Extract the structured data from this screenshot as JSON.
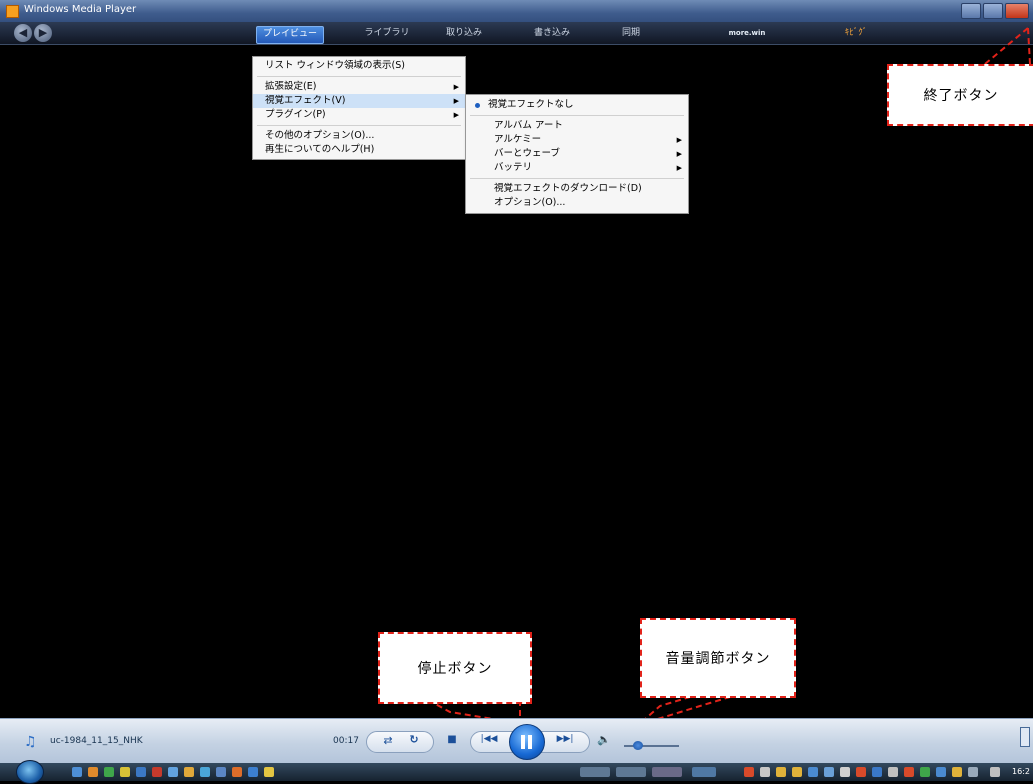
{
  "window": {
    "title": "Windows Media Player"
  },
  "navbar": {
    "back_icon": "back-arrow-icon",
    "forward_icon": "forward-arrow-icon",
    "tabs": [
      {
        "label": "プレイビュー",
        "active": true
      },
      {
        "label": "ライブラリ"
      },
      {
        "label": "取り込み"
      },
      {
        "label": "書き込み"
      },
      {
        "label": "同期"
      },
      {
        "label": "more.win"
      },
      {
        "label": "ｷﾋﾞｸﾞ"
      }
    ]
  },
  "menu": {
    "items": [
      {
        "label": "リスト ウィンドウ領域の表示(S)"
      },
      {
        "label": "拡張設定(E)",
        "submenu": true
      },
      {
        "label": "視覚エフェクト(V)",
        "submenu": true,
        "highlighted": true
      },
      {
        "label": "プラグイン(P)",
        "submenu": true
      },
      {
        "label": "その他のオプション(O)..."
      },
      {
        "label": "再生についてのヘルプ(H)"
      }
    ]
  },
  "submenu": {
    "items": [
      {
        "label": "視覚エフェクトなし",
        "selected": true
      },
      {
        "label": "アルバム アート"
      },
      {
        "label": "アルケミー",
        "submenu": true
      },
      {
        "label": "バーとウェーブ",
        "submenu": true
      },
      {
        "label": "バッテリ",
        "submenu": true
      },
      {
        "label": "視覚エフェクトのダウンロード(D)"
      },
      {
        "label": "オプション(O)..."
      }
    ]
  },
  "annotations": {
    "exit": "終了ボタン",
    "stop": "停止ボタン",
    "volume": "音量調節ボタン",
    "color": "#e2231a"
  },
  "player": {
    "track_name": "uc-1984_11_15_NHK",
    "time": "00:17",
    "shuffle_icon": "shuffle-icon",
    "repeat_icon": "repeat-icon",
    "stop_icon": "stop-icon",
    "prev_icon": "previous-icon",
    "play_state": "paused-icon",
    "next_icon": "next-icon",
    "volume_icon": "speaker-icon",
    "volume_level": 0.25
  },
  "taskbar": {
    "clock": "16:2"
  },
  "colors": {
    "accent": "#2459b8",
    "background": "#000000"
  }
}
